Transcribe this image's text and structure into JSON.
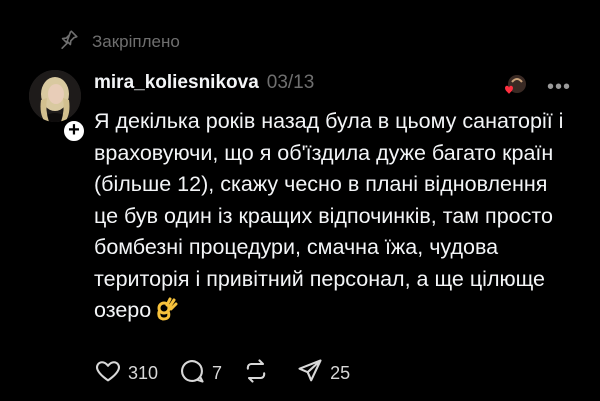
{
  "pinned": {
    "label": "Закріплено",
    "icon": "pin-icon"
  },
  "post": {
    "username": "mira_koliesnikova",
    "date": "03/13",
    "text": "Я декілька років назад була в цьому санаторії і враховуючи, що я об'їздила дуже багато країн (більше 12), скажу чесно в плані відновлення це був один із кращих відпочинків, там просто бомбезні процедури, смачна їжа, чудова територія і привітний персонал, а ще цілюще озеро",
    "emoji_icon": "ok-hand-emoji-icon",
    "liked_by_icon": "liked-by-author-heart-icon"
  },
  "actions": {
    "likes": "310",
    "comments": "7",
    "reposts": "",
    "shares": "25"
  },
  "colors": {
    "background": "#000000",
    "text": "#f3f5f7",
    "muted": "#6f6f6f",
    "heart": "#ff3040"
  }
}
